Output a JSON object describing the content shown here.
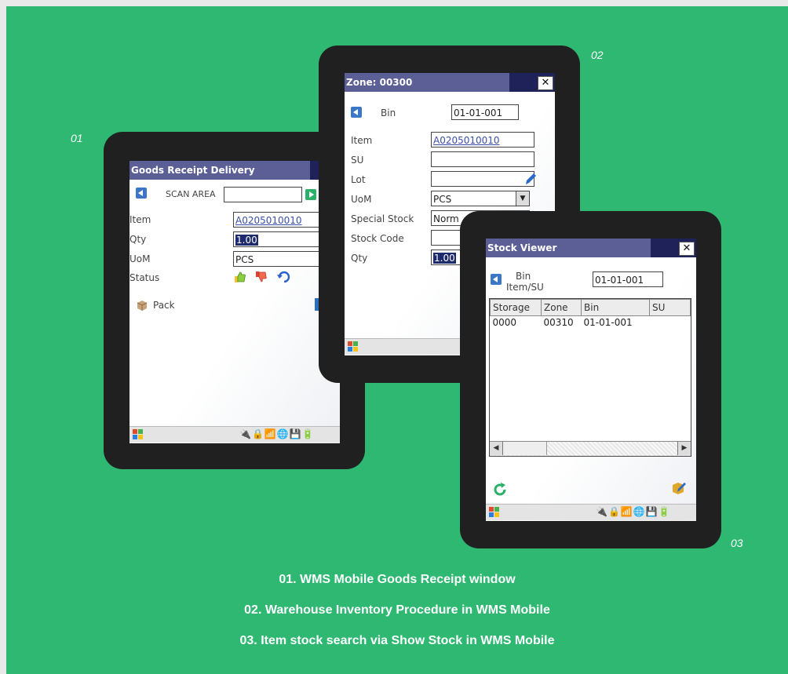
{
  "labels": {
    "n1": "01",
    "n2": "02",
    "n3": "03"
  },
  "captions": [
    "01. WMS Mobile Goods Receipt window",
    "02. Warehouse Inventory Procedure in WMS Mobile",
    "03. Item stock search via Show Stock in WMS Mobile"
  ],
  "screen1": {
    "title": "Goods Receipt Delivery",
    "scan_label": "SCAN AREA",
    "scan_value": "",
    "item_label": "Item",
    "item_value": "A0205010010",
    "qty_label": "Qty",
    "qty_value": "1.00",
    "uom_label": "UoM",
    "uom_value": "PCS",
    "status_label": "Status",
    "pack_label": "Pack"
  },
  "screen2": {
    "title": "Zone: 00300",
    "close": "✕",
    "bin_label": "Bin",
    "bin_value": "01-01-001",
    "item_label": "Item",
    "item_value": "A0205010010",
    "su_label": "SU",
    "lot_label": "Lot",
    "uom_label": "UoM",
    "uom_value": "PCS",
    "special_label": "Special Stock",
    "special_value": "Norm",
    "stockcode_label": "Stock Code",
    "qty_label": "Qty",
    "qty_value": "1.00"
  },
  "screen3": {
    "title": "Stock Viewer",
    "close": "✕",
    "bin_label": "Bin",
    "itemsu_label": "Item/SU",
    "bin_value": "01-01-001",
    "columns": [
      "Storage",
      "Zone",
      "Bin",
      "SU"
    ],
    "rows": [
      [
        "0000",
        "00310",
        "01-01-001",
        ""
      ]
    ]
  },
  "colors": {
    "background": "#2eb872",
    "titlebar": "#5b5f96",
    "device": "#202020"
  }
}
